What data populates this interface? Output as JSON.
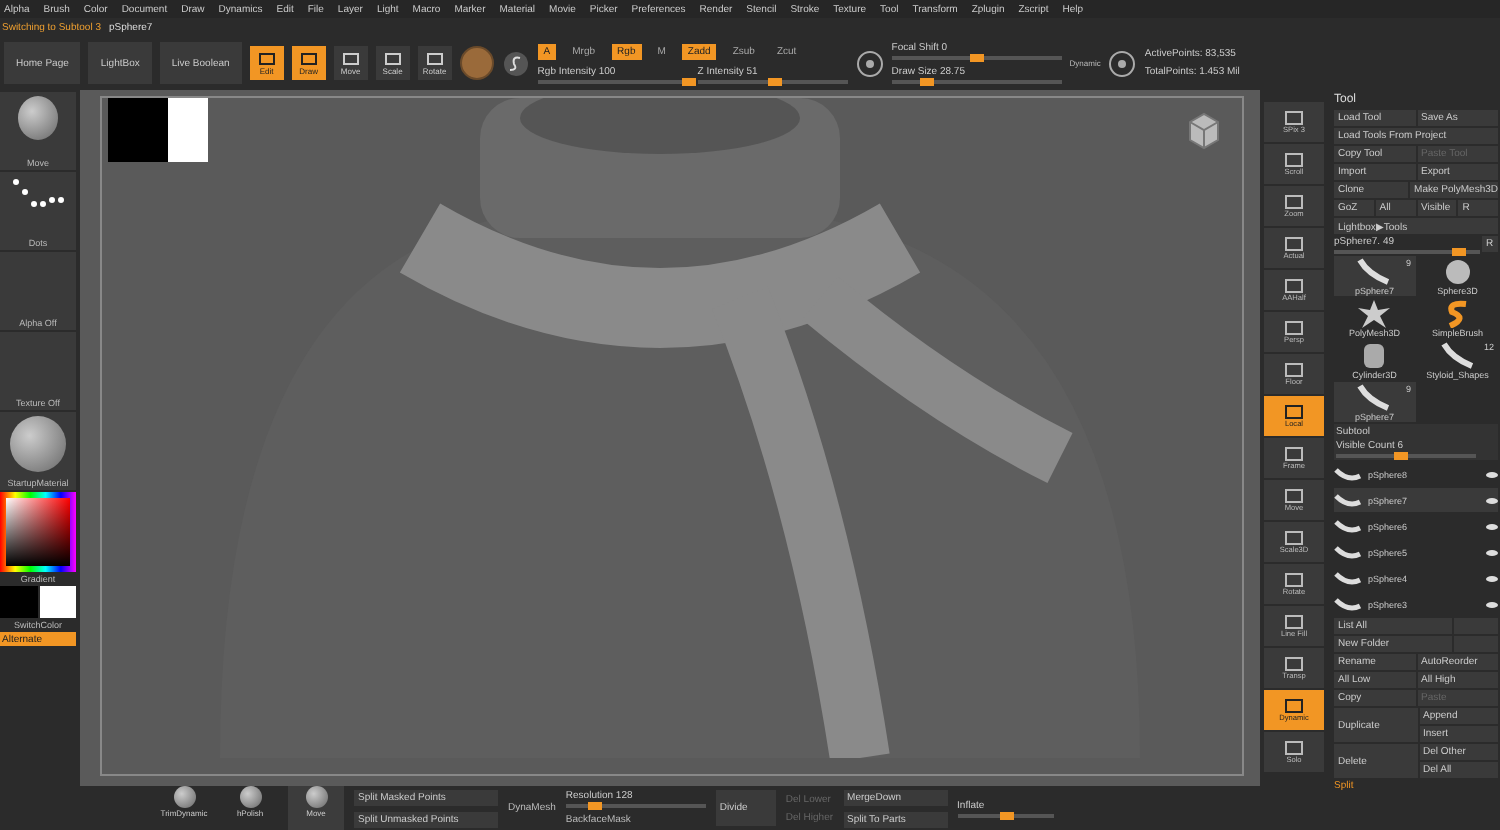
{
  "menu": [
    "Alpha",
    "Brush",
    "Color",
    "Document",
    "Draw",
    "Dynamics",
    "Edit",
    "File",
    "Layer",
    "Light",
    "Macro",
    "Marker",
    "Material",
    "Movie",
    "Picker",
    "Preferences",
    "Render",
    "Stencil",
    "Stroke",
    "Texture",
    "Tool",
    "Transform",
    "Zplugin",
    "Zscript",
    "Help"
  ],
  "status": {
    "message": "Switching to Subtool 3",
    "tool": "pSphere7"
  },
  "toolbar": {
    "buttons": [
      "Home Page",
      "LightBox",
      "Live Boolean"
    ],
    "modes": [
      {
        "label": "Edit",
        "selected": true
      },
      {
        "label": "Draw",
        "selected": true
      },
      {
        "label": "Move",
        "selected": false
      },
      {
        "label": "Scale",
        "selected": false
      },
      {
        "label": "Rotate",
        "selected": false
      }
    ],
    "channels": [
      {
        "label": "A",
        "on": true
      },
      {
        "label": "Mrgb",
        "on": false
      },
      {
        "label": "Rgb",
        "on": true
      },
      {
        "label": "M",
        "on": false
      },
      {
        "label": "Zadd",
        "on": true
      },
      {
        "label": "Zsub",
        "on": false
      },
      {
        "label": "Zcut",
        "on": false
      }
    ],
    "intensity": [
      {
        "label": "Rgb Intensity 100",
        "level": 1.0
      },
      {
        "label": "Z Intensity 51",
        "level": 0.51
      }
    ],
    "draw": [
      {
        "label": "Focal Shift 0",
        "level": 0.5
      },
      {
        "label": "Draw Size 28.75",
        "level": 0.2
      }
    ],
    "dynamic": "Dynamic",
    "stats": [
      "ActivePoints: 83,535",
      "TotalPoints: 1.453 Mil"
    ]
  },
  "left": {
    "tiles": [
      {
        "label": "Move",
        "kind": "brush"
      },
      {
        "label": "Dots",
        "kind": "stroke"
      },
      {
        "label": "Alpha Off",
        "kind": "empty"
      },
      {
        "label": "Texture Off",
        "kind": "empty"
      },
      {
        "label": "StartupMaterial",
        "kind": "material"
      }
    ],
    "gradient": "Gradient",
    "switch_color": "SwitchColor",
    "alternate": "Alternate"
  },
  "shelf": [
    {
      "label": "SPix 3",
      "selected": false
    },
    {
      "label": "Scroll",
      "selected": false
    },
    {
      "label": "Zoom",
      "selected": false
    },
    {
      "label": "Actual",
      "selected": false
    },
    {
      "label": "AAHalf",
      "selected": false
    },
    {
      "label": "Persp",
      "selected": false
    },
    {
      "label": "Floor",
      "selected": false
    },
    {
      "label": "Local",
      "selected": true
    },
    {
      "label": "Frame",
      "selected": false
    },
    {
      "label": "Move",
      "selected": false
    },
    {
      "label": "Scale3D",
      "selected": false
    },
    {
      "label": "Rotate",
      "selected": false
    },
    {
      "label": "Line Fill",
      "selected": false
    },
    {
      "label": "Transp",
      "selected": false
    },
    {
      "label": "Dynamic",
      "selected": true
    },
    {
      "label": "Solo",
      "selected": false
    }
  ],
  "tool": {
    "title": "Tool",
    "rows": [
      [
        {
          "label": "Load Tool",
          "disabled": false
        },
        {
          "label": "Save As",
          "disabled": false
        }
      ],
      [
        {
          "label": "Load Tools From Project",
          "disabled": false
        }
      ],
      [
        {
          "label": "Copy Tool",
          "disabled": false
        },
        {
          "label": "Paste Tool",
          "disabled": true
        }
      ],
      [
        {
          "label": "Import",
          "disabled": false
        },
        {
          "label": "Export",
          "disabled": false
        }
      ],
      [
        {
          "label": "Clone",
          "disabled": false
        },
        {
          "label": "Make PolyMesh3D",
          "disabled": false
        }
      ],
      [
        {
          "label": "GoZ",
          "disabled": false
        },
        {
          "label": "All",
          "disabled": false
        },
        {
          "label": "Visible",
          "disabled": false
        },
        {
          "label": "R",
          "disabled": false
        }
      ],
      [
        {
          "label": "Lightbox▶Tools",
          "disabled": false
        }
      ]
    ],
    "current": {
      "label": "pSphere7. 49",
      "level": 0.9,
      "reset": "R"
    },
    "thumbs": [
      {
        "label": "pSphere7",
        "count": "9",
        "kind": "rope",
        "selected": true
      },
      {
        "label": "Sphere3D",
        "kind": "sphere",
        "selected": false
      },
      {
        "label": "PolyMesh3D",
        "kind": "star",
        "selected": false
      },
      {
        "label": "SimpleBrush",
        "kind": "brush",
        "selected": false
      },
      {
        "label": "Cylinder3D",
        "kind": "cylinder",
        "selected": false
      },
      {
        "label": "Styloid_Shapes",
        "count": "12",
        "kind": "rope",
        "selected": false
      },
      {
        "label": "pSphere7",
        "count": "9",
        "kind": "rope",
        "selected": true
      }
    ],
    "subtool_title": "Subtool",
    "visible_count": {
      "label": "Visible Count 6",
      "level": 0.45
    },
    "subtools": [
      {
        "label": "pSphere8",
        "selected": false
      },
      {
        "label": "pSphere7",
        "selected": true
      },
      {
        "label": "pSphere6",
        "selected": false
      },
      {
        "label": "pSphere5",
        "selected": false
      },
      {
        "label": "pSphere4",
        "selected": false
      },
      {
        "label": "pSphere3",
        "selected": false
      }
    ],
    "list_buttons": [
      "List All",
      "New Folder"
    ],
    "actions": [
      [
        {
          "label": "Rename",
          "disabled": false
        },
        {
          "label": "AutoReorder",
          "disabled": false
        }
      ],
      [
        {
          "label": "All Low",
          "disabled": false
        },
        {
          "label": "All High",
          "disabled": false
        }
      ],
      [
        {
          "label": "Copy",
          "disabled": false
        },
        {
          "label": "Paste",
          "disabled": true
        }
      ]
    ],
    "duplicate": [
      "Duplicate",
      "Append",
      "Insert"
    ],
    "delete": [
      "Delete",
      "Del Other",
      "Del All"
    ],
    "split": "Split"
  },
  "bottom": {
    "brushes": [
      {
        "label": "TrimDynamic",
        "selected": false
      },
      {
        "label": "hPolish",
        "selected": false
      },
      {
        "label": "Move",
        "selected": true
      }
    ],
    "split": [
      "Split Masked Points",
      "Split Unmasked Points"
    ],
    "dynamesh": "DynaMesh",
    "resolution": {
      "label": "Resolution 128",
      "level": 0.2
    },
    "backface": "BackfaceMask",
    "divide": "Divide",
    "lower": [
      {
        "label": "Del Lower",
        "disabled": true
      },
      {
        "label": "Del Higher",
        "disabled": true
      }
    ],
    "merge": [
      "MergeDown",
      "Split To Parts"
    ],
    "inflate": {
      "label": "Inflate",
      "level": 0.5
    }
  }
}
